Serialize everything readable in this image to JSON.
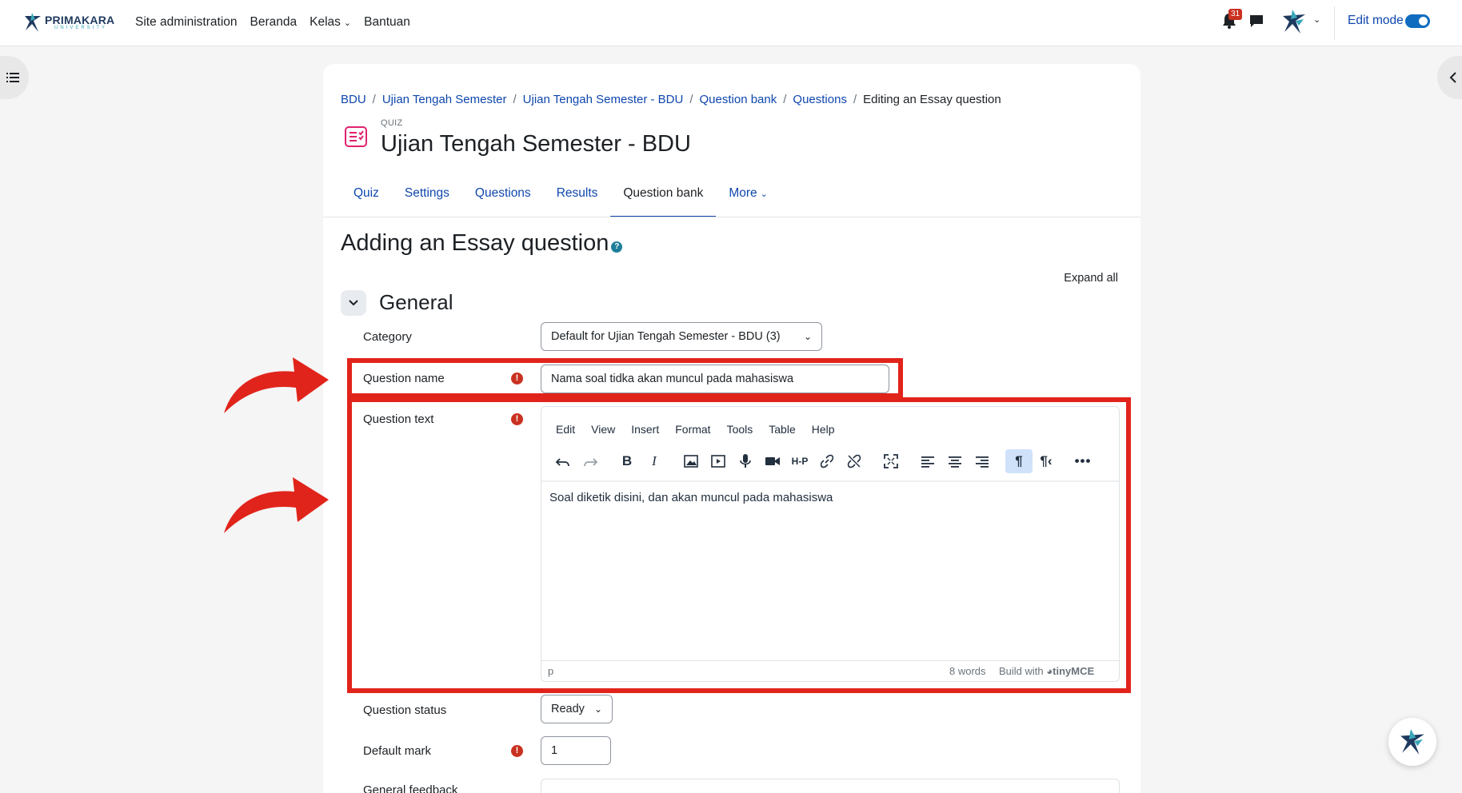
{
  "nav": {
    "brand_line1": "PRIMAKARA",
    "brand_line2": "UNIVERSITY",
    "links": [
      "Site administration",
      "Beranda",
      "Kelas",
      "Bantuan"
    ],
    "notification_count": "31",
    "edit_mode_label": "Edit mode",
    "edit_mode_on": true
  },
  "breadcrumb": [
    "BDU",
    "Ujian Tengah Semester",
    "Ujian Tengah Semester - BDU",
    "Question bank",
    "Questions",
    "Editing an Essay question"
  ],
  "header": {
    "module_label": "QUIZ",
    "title": "Ujian Tengah Semester - BDU"
  },
  "tabs": [
    "Quiz",
    "Settings",
    "Questions",
    "Results",
    "Question bank",
    "More"
  ],
  "active_tab": "Question bank",
  "page": {
    "heading": "Adding an Essay question",
    "expand_all": "Expand all",
    "section_title": "General"
  },
  "form": {
    "category_label": "Category",
    "category_value": "Default for Ujian Tengah Semester - BDU (3)",
    "question_name_label": "Question name",
    "question_name_value": "Nama soal tidka akan muncul pada mahasiswa",
    "question_text_label": "Question text",
    "question_status_label": "Question status",
    "question_status_value": "Ready",
    "default_mark_label": "Default mark",
    "default_mark_value": "1",
    "general_feedback_label": "General feedback"
  },
  "editor": {
    "menu": [
      "Edit",
      "View",
      "Insert",
      "Format",
      "Tools",
      "Table",
      "Help"
    ],
    "content": "Soal diketik disini, dan akan muncul pada mahasiswa",
    "status_path": "p",
    "word_count": "8 words",
    "build_with": "Build with",
    "tiny_brand": "tinyMCE"
  },
  "colors": {
    "link": "#0f47ad",
    "annotation_red": "#e1241b",
    "required_red": "#ca3120",
    "toggle_blue": "#0f6cbf"
  }
}
